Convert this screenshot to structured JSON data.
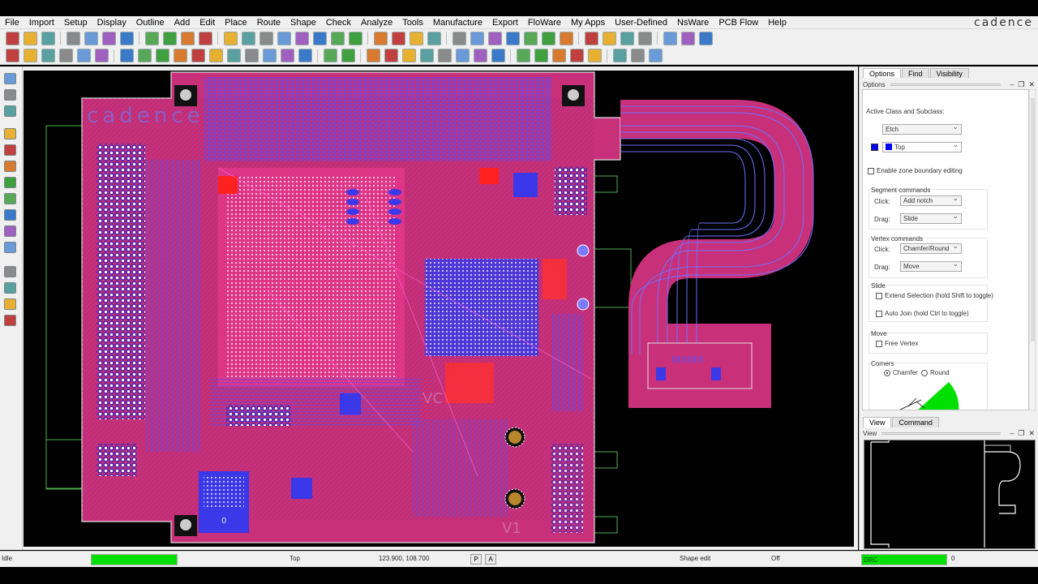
{
  "brand": "cadence",
  "menu": [
    "File",
    "Import",
    "Setup",
    "Display",
    "Outline",
    "Add",
    "Edit",
    "Place",
    "Route",
    "Shape",
    "Check",
    "Analyze",
    "Tools",
    "Manufacture",
    "Export",
    "FloWare",
    "My Apps",
    "User-Defined",
    "NsWare",
    "PCB Flow",
    "Help"
  ],
  "panel": {
    "tabs": [
      "Options",
      "Find",
      "Visibility"
    ],
    "header": "Options",
    "active_class_label": "Active Class and Subclass:",
    "class_value": "Etch",
    "subclass_value": "Top",
    "enable_zone_label": "Enable zone boundary editing",
    "segment_commands_label": "Segment commands",
    "click_label": "Click:",
    "drag_label": "Drag:",
    "segment_click_value": "Add notch",
    "segment_drag_value": "Slide",
    "vertex_commands_label": "Vertex commands",
    "vertex_click_value": "Chamfer/Round",
    "vertex_drag_value": "Move",
    "slide_label": "Slide",
    "extend_selection_label": "Extend Selection (hold Shift to toggle)",
    "auto_join_label": "Auto Join (hold Ctrl to toggle)",
    "move_label": "Move",
    "free_vertex_label": "Free Vertex",
    "corners_label": "Corners",
    "chamfer_label": "Chamfer",
    "round_label": "Round"
  },
  "view_panel": {
    "tabs": [
      "View",
      "Command"
    ],
    "header": "View"
  },
  "board_text": {
    "logo": "cadence",
    "vc": "VC",
    "v1": "V1",
    "zero": "0"
  },
  "status": {
    "state": "Idle",
    "layer": "Top",
    "coords": "123.900, 108.700",
    "p_btn": "P",
    "a_btn": "A",
    "mode": "Shape edit",
    "off": "Off",
    "drc": "DRC",
    "drc_count": "0"
  },
  "colors": {
    "board": "#c8307a",
    "top_etch": "#3a38e8",
    "highlight": "#ff2a2a",
    "drc_green": "#00e000"
  }
}
